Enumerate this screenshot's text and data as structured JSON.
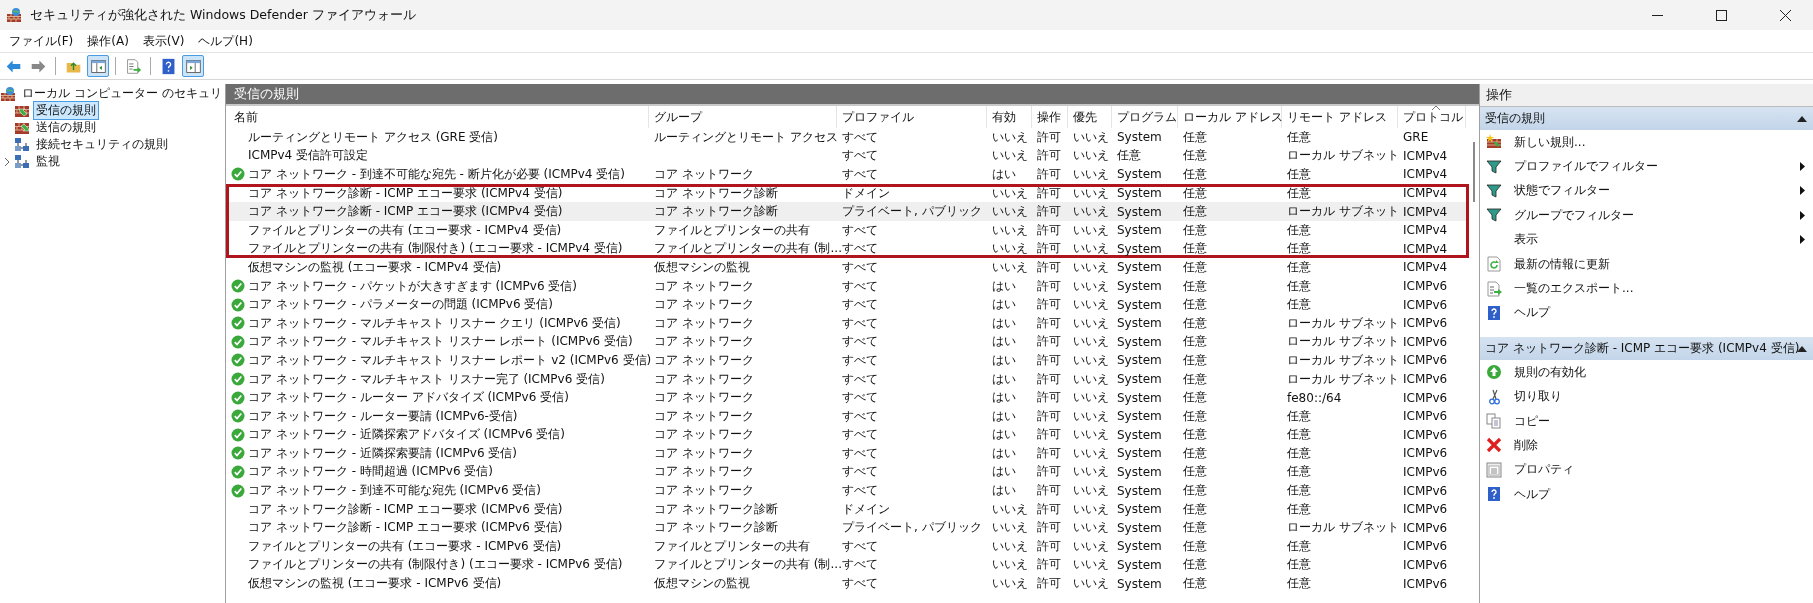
{
  "window": {
    "title": "セキュリティが強化された Windows Defender ファイアウォール"
  },
  "menu": [
    "ファイル(F)",
    "操作(A)",
    "表示(V)",
    "ヘルプ(H)"
  ],
  "toolbar": [
    {
      "pressed": false
    },
    {
      "pressed": false
    },
    {
      "pressed": false
    },
    {
      "pressed": true
    },
    {
      "pressed": false
    },
    {
      "pressed": false
    },
    {
      "pressed": true
    }
  ],
  "tree": {
    "label": "ローカル コンピューター のセキュリ",
    "children": [
      {
        "label": "受信の規則",
        "selected": true,
        "collapsed": false
      },
      {
        "label": "送信の規則",
        "selected": false,
        "collapsed": false
      },
      {
        "label": "接続セキュリティの規則",
        "selected": false,
        "collapsed": false
      },
      {
        "label": "監視",
        "selected": false,
        "collapsed": true
      }
    ]
  },
  "table": {
    "title": "受信の規則",
    "columns": [
      {
        "label": "名前",
        "sorted": false
      },
      {
        "label": "グループ",
        "sorted": false
      },
      {
        "label": "プロファイル",
        "sorted": false
      },
      {
        "label": "有効",
        "sorted": false
      },
      {
        "label": "操作",
        "sorted": false
      },
      {
        "label": "優先",
        "sorted": false
      },
      {
        "label": "プログラム",
        "sorted": false
      },
      {
        "label": "ローカル アドレス",
        "sorted": false
      },
      {
        "label": "リモート アドレス",
        "sorted": false
      },
      {
        "label": "プロトコル",
        "sorted": true
      }
    ],
    "rows": [
      {
        "enabled": false,
        "selected": false,
        "highlighted": false,
        "cells": [
          "ルーティングとリモート アクセス (GRE 受信)",
          "ルーティングとリモート アクセス",
          "すべて",
          "いいえ",
          "許可",
          "いいえ",
          "System",
          "任意",
          "任意",
          "GRE"
        ]
      },
      {
        "enabled": false,
        "selected": false,
        "highlighted": false,
        "cells": [
          "ICMPv4 受信許可設定",
          null,
          "すべて",
          "いいえ",
          "許可",
          "いいえ",
          "任意",
          "任意",
          "ローカル サブネット",
          "ICMPv4"
        ]
      },
      {
        "enabled": true,
        "selected": false,
        "highlighted": false,
        "cells": [
          "コア ネットワーク - 到達不可能な宛先 - 断片化が必要 (ICMPv4 受信)",
          "コア ネットワーク",
          "すべて",
          "はい",
          "許可",
          "いいえ",
          "System",
          "任意",
          "任意",
          "ICMPv4"
        ]
      },
      {
        "enabled": false,
        "selected": false,
        "highlighted": true,
        "cells": [
          "コア ネットワーク診断 - ICMP エコー要求 (ICMPv4 受信)",
          "コア ネットワーク診断",
          "ドメイン",
          "いいえ",
          "許可",
          "いいえ",
          "System",
          "任意",
          "任意",
          "ICMPv4"
        ]
      },
      {
        "enabled": false,
        "selected": true,
        "highlighted": true,
        "cells": [
          "コア ネットワーク診断 - ICMP エコー要求 (ICMPv4 受信)",
          "コア ネットワーク診断",
          "プライベート, パブリック",
          "いいえ",
          "許可",
          "いいえ",
          "System",
          "任意",
          "ローカル サブネット",
          "ICMPv4"
        ]
      },
      {
        "enabled": false,
        "selected": false,
        "highlighted": true,
        "cells": [
          "ファイルとプリンターの共有 (エコー要求 - ICMPv4 受信)",
          "ファイルとプリンターの共有",
          "すべて",
          "いいえ",
          "許可",
          "いいえ",
          "System",
          "任意",
          "任意",
          "ICMPv4"
        ]
      },
      {
        "enabled": false,
        "selected": false,
        "highlighted": true,
        "cells": [
          "ファイルとプリンターの共有 (制限付き) (エコー要求 - ICMPv4 受信)",
          "ファイルとプリンターの共有 (制...",
          "すべて",
          "いいえ",
          "許可",
          "いいえ",
          "System",
          "任意",
          "任意",
          "ICMPv4"
        ]
      },
      {
        "enabled": false,
        "selected": false,
        "highlighted": false,
        "cells": [
          "仮想マシンの監視 (エコー要求 - ICMPv4 受信)",
          "仮想マシンの監視",
          "すべて",
          "いいえ",
          "許可",
          "いいえ",
          "System",
          "任意",
          "任意",
          "ICMPv4"
        ]
      },
      {
        "enabled": true,
        "selected": false,
        "highlighted": false,
        "cells": [
          "コア ネットワーク - パケットが大きすぎます (ICMPv6 受信)",
          "コア ネットワーク",
          "すべて",
          "はい",
          "許可",
          "いいえ",
          "System",
          "任意",
          "任意",
          "ICMPv6"
        ]
      },
      {
        "enabled": true,
        "selected": false,
        "highlighted": false,
        "cells": [
          "コア ネットワーク - パラメーターの問題 (ICMPv6 受信)",
          "コア ネットワーク",
          "すべて",
          "はい",
          "許可",
          "いいえ",
          "System",
          "任意",
          "任意",
          "ICMPv6"
        ]
      },
      {
        "enabled": true,
        "selected": false,
        "highlighted": false,
        "cells": [
          "コア ネットワーク - マルチキャスト リスナー クエリ (ICMPv6 受信)",
          "コア ネットワーク",
          "すべて",
          "はい",
          "許可",
          "いいえ",
          "System",
          "任意",
          "ローカル サブネット",
          "ICMPv6"
        ]
      },
      {
        "enabled": true,
        "selected": false,
        "highlighted": false,
        "cells": [
          "コア ネットワーク - マルチキャスト リスナー レポート (ICMPv6 受信)",
          "コア ネットワーク",
          "すべて",
          "はい",
          "許可",
          "いいえ",
          "System",
          "任意",
          "ローカル サブネット",
          "ICMPv6"
        ]
      },
      {
        "enabled": true,
        "selected": false,
        "highlighted": false,
        "cells": [
          "コア ネットワーク - マルチキャスト リスナー レポート v2 (ICMPv6 受信)",
          "コア ネットワーク",
          "すべて",
          "はい",
          "許可",
          "いいえ",
          "System",
          "任意",
          "ローカル サブネット",
          "ICMPv6"
        ]
      },
      {
        "enabled": true,
        "selected": false,
        "highlighted": false,
        "cells": [
          "コア ネットワーク - マルチキャスト リスナー完了 (ICMPv6 受信)",
          "コア ネットワーク",
          "すべて",
          "はい",
          "許可",
          "いいえ",
          "System",
          "任意",
          "ローカル サブネット",
          "ICMPv6"
        ]
      },
      {
        "enabled": true,
        "selected": false,
        "highlighted": false,
        "cells": [
          "コア ネットワーク - ルーター アドバタイズ (ICMPv6 受信)",
          "コア ネットワーク",
          "すべて",
          "はい",
          "許可",
          "いいえ",
          "System",
          "任意",
          "fe80::/64",
          "ICMPv6"
        ]
      },
      {
        "enabled": true,
        "selected": false,
        "highlighted": false,
        "cells": [
          "コア ネットワーク - ルーター要請 (ICMPv6-受信)",
          "コア ネットワーク",
          "すべて",
          "はい",
          "許可",
          "いいえ",
          "System",
          "任意",
          "任意",
          "ICMPv6"
        ]
      },
      {
        "enabled": true,
        "selected": false,
        "highlighted": false,
        "cells": [
          "コア ネットワーク - 近隣探索アドバタイズ (ICMPv6 受信)",
          "コア ネットワーク",
          "すべて",
          "はい",
          "許可",
          "いいえ",
          "System",
          "任意",
          "任意",
          "ICMPv6"
        ]
      },
      {
        "enabled": true,
        "selected": false,
        "highlighted": false,
        "cells": [
          "コア ネットワーク - 近隣探索要請 (ICMPv6 受信)",
          "コア ネットワーク",
          "すべて",
          "はい",
          "許可",
          "いいえ",
          "System",
          "任意",
          "任意",
          "ICMPv6"
        ]
      },
      {
        "enabled": true,
        "selected": false,
        "highlighted": false,
        "cells": [
          "コア ネットワーク - 時間超過 (ICMPv6 受信)",
          "コア ネットワーク",
          "すべて",
          "はい",
          "許可",
          "いいえ",
          "System",
          "任意",
          "任意",
          "ICMPv6"
        ]
      },
      {
        "enabled": true,
        "selected": false,
        "highlighted": false,
        "cells": [
          "コア ネットワーク - 到達不可能な宛先 (ICMPv6 受信)",
          "コア ネットワーク",
          "すべて",
          "はい",
          "許可",
          "いいえ",
          "System",
          "任意",
          "任意",
          "ICMPv6"
        ]
      },
      {
        "enabled": false,
        "selected": false,
        "highlighted": false,
        "cells": [
          "コア ネットワーク診断 - ICMP エコー要求 (ICMPv6 受信)",
          "コア ネットワーク診断",
          "ドメイン",
          "いいえ",
          "許可",
          "いいえ",
          "System",
          "任意",
          "任意",
          "ICMPv6"
        ]
      },
      {
        "enabled": false,
        "selected": false,
        "highlighted": false,
        "cells": [
          "コア ネットワーク診断 - ICMP エコー要求 (ICMPv6 受信)",
          "コア ネットワーク診断",
          "プライベート, パブリック",
          "いいえ",
          "許可",
          "いいえ",
          "System",
          "任意",
          "ローカル サブネット",
          "ICMPv6"
        ]
      },
      {
        "enabled": false,
        "selected": false,
        "highlighted": false,
        "cells": [
          "ファイルとプリンターの共有 (エコー要求 - ICMPv6 受信)",
          "ファイルとプリンターの共有",
          "すべて",
          "いいえ",
          "許可",
          "いいえ",
          "System",
          "任意",
          "任意",
          "ICMPv6"
        ]
      },
      {
        "enabled": false,
        "selected": false,
        "highlighted": false,
        "cells": [
          "ファイルとプリンターの共有 (制限付き) (エコー要求 - ICMPv6 受信)",
          "ファイルとプリンターの共有 (制...",
          "すべて",
          "いいえ",
          "許可",
          "いいえ",
          "System",
          "任意",
          "任意",
          "ICMPv6"
        ]
      },
      {
        "enabled": false,
        "selected": false,
        "highlighted": false,
        "cells": [
          "仮想マシンの監視 (エコー要求 - ICMPv6 受信)",
          "仮想マシンの監視",
          "すべて",
          "いいえ",
          "許可",
          "いいえ",
          "System",
          "任意",
          "任意",
          "ICMPv6"
        ]
      }
    ]
  },
  "actions": {
    "title": "操作",
    "sections": [
      {
        "title": "受信の規則",
        "expanded": true,
        "items": [
          {
            "label": "新しい規則...",
            "submenu": false
          },
          {
            "label": "プロファイルでフィルター",
            "submenu": true
          },
          {
            "label": "状態でフィルター",
            "submenu": true
          },
          {
            "label": "グループでフィルター",
            "submenu": true
          },
          {
            "label": "表示",
            "submenu": true
          },
          {
            "label": "最新の情報に更新",
            "submenu": false
          },
          {
            "label": "一覧のエクスポート...",
            "submenu": false
          },
          {
            "label": "ヘルプ",
            "submenu": false
          }
        ]
      },
      {
        "title": "コア ネットワーク診断 - ICMP エコー要求 (ICMPv4 受信)",
        "expanded": true,
        "items": [
          {
            "label": "規則の有効化",
            "submenu": false
          },
          {
            "label": "切り取り",
            "submenu": false
          },
          {
            "label": "コピー",
            "submenu": false
          },
          {
            "label": "削除",
            "submenu": false
          },
          {
            "label": "プロパティ",
            "submenu": false
          },
          {
            "label": "ヘルプ",
            "submenu": false
          }
        ]
      }
    ]
  }
}
